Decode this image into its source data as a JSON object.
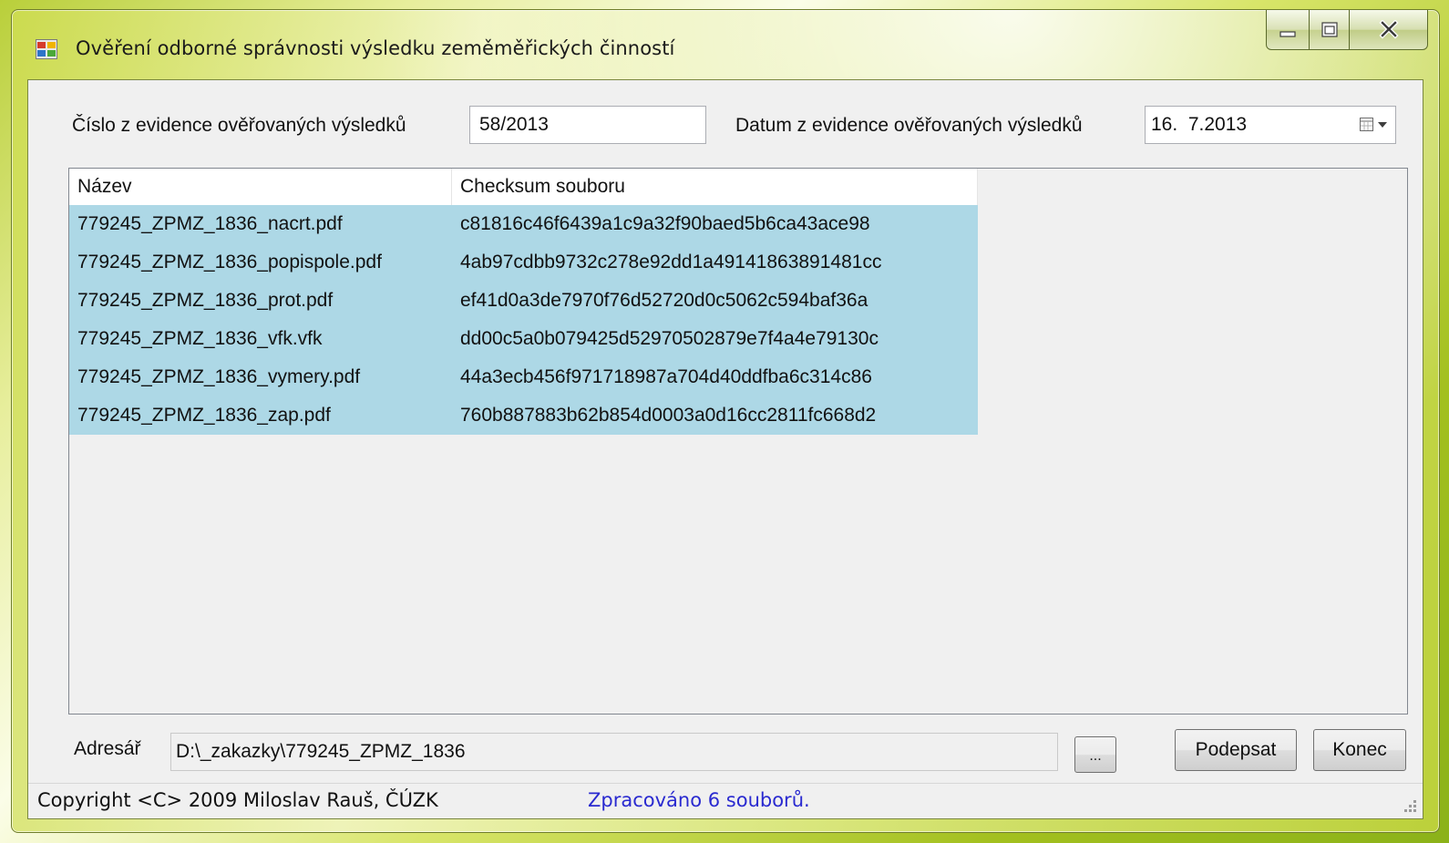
{
  "window": {
    "title": "Ověření odborné správnosti výsledku zeměměřických činností"
  },
  "form": {
    "number_label": "Číslo z evidence ověřovaných výsledků",
    "number_value": "58/2013",
    "date_label": "Datum z evidence ověřovaných výsledků",
    "date_value": "16.  7.2013"
  },
  "list": {
    "columns": [
      "Název",
      "Checksum souboru"
    ],
    "rows": [
      {
        "name": "779245_ZPMZ_1836_nacrt.pdf",
        "checksum": "c81816c46f6439a1c9a32f90baed5b6ca43ace98"
      },
      {
        "name": "779245_ZPMZ_1836_popispole.pdf",
        "checksum": "4ab97cdbb9732c278e92dd1a49141863891481cc"
      },
      {
        "name": "779245_ZPMZ_1836_prot.pdf",
        "checksum": "ef41d0a3de7970f76d52720d0c5062c594baf36a"
      },
      {
        "name": "779245_ZPMZ_1836_vfk.vfk",
        "checksum": "dd00c5a0b079425d52970502879e7f4a4e79130c"
      },
      {
        "name": "779245_ZPMZ_1836_vymery.pdf",
        "checksum": "44a3ecb456f971718987a704d40ddfba6c314c86"
      },
      {
        "name": "779245_ZPMZ_1836_zap.pdf",
        "checksum": "760b887883b62b854d0003a0d16cc2811fc668d2"
      }
    ]
  },
  "directory": {
    "label": "Adresář",
    "value": "D:\\_zakazky\\779245_ZPMZ_1836",
    "browse_label": "..."
  },
  "buttons": {
    "sign_label": "Podepsat",
    "close_label": "Konec"
  },
  "status": {
    "copyright": "Copyright <C> 2009 Miloslav Rauš, ČÚZK",
    "message": "Zpracováno 6 souborů."
  },
  "colors": {
    "selection": "#add8e6",
    "status_message": "#2a2ad0"
  }
}
